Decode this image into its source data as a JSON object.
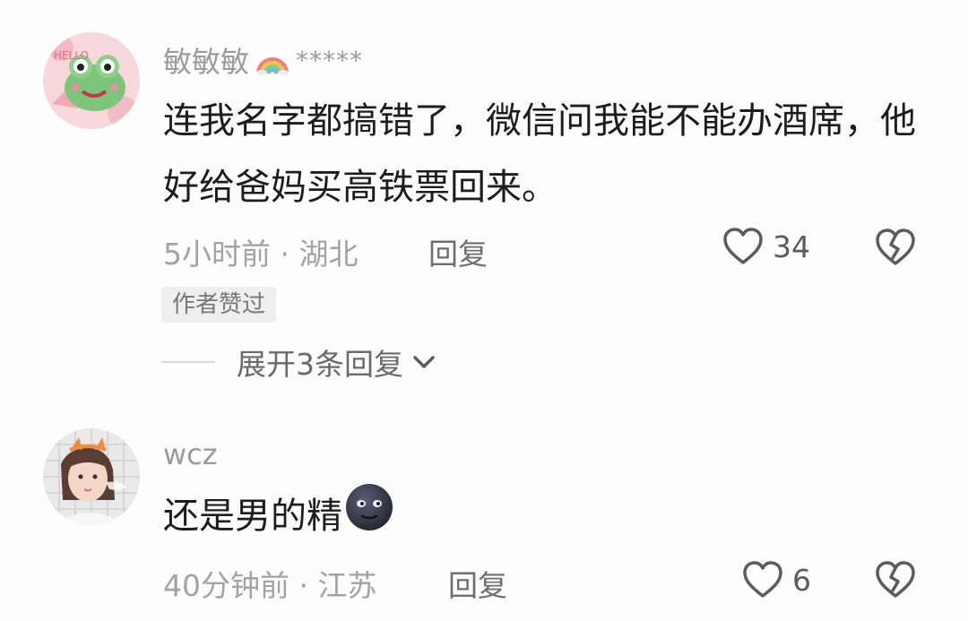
{
  "comments": [
    {
      "username": "敏敏敏",
      "username_suffix": "*****",
      "text": "连我名字都搞错了，微信问我能不能办酒席，他好给爸妈买高铁票回来。",
      "time_location": "5小时前 · 湖北",
      "reply_label": "回复",
      "like_count": "34",
      "author_badge": "作者赞过",
      "expand_label": "展开3条回复"
    },
    {
      "username": "wcz",
      "text": "还是男的精",
      "time_location": "40分钟前 · 江苏",
      "reply_label": "回复",
      "like_count": "6"
    }
  ],
  "icons": {
    "like": "heart-outline-icon",
    "dislike": "broken-heart-icon",
    "expand": "chevron-down-icon",
    "rainbow": "rainbow-emoji-icon",
    "moon": "new-moon-face-emoji-icon"
  },
  "colors": {
    "text_primary": "#1d1d1d",
    "text_secondary": "#9b9b9b",
    "badge_bg": "#eeeeee"
  }
}
